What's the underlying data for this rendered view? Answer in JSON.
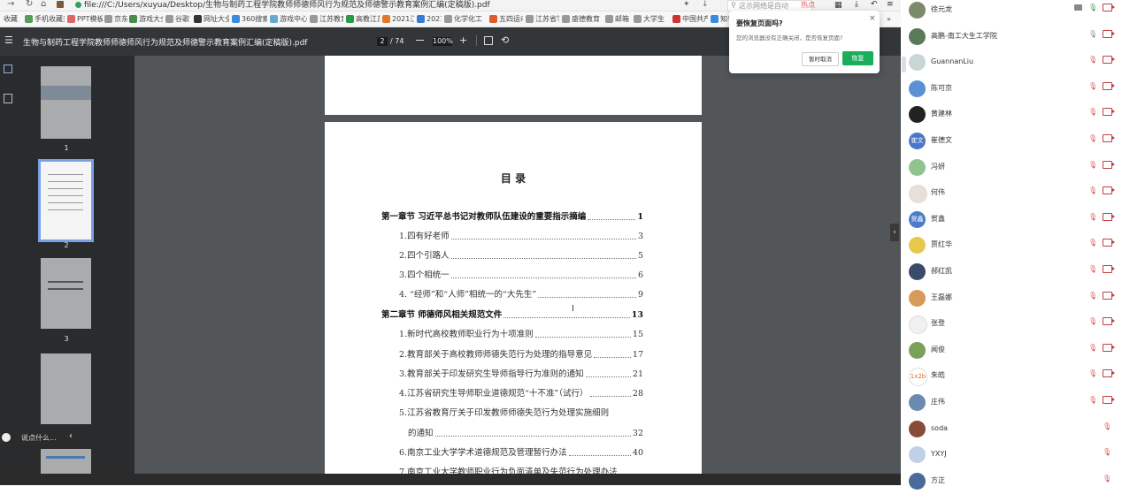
{
  "browser": {
    "url": "file:///C:/Users/xuyua/Desktop/生物与制药工程学院教师师德师风行为规范及师德警示教育案例汇编(定稿版).pdf",
    "search_placeholder": "这示网络是自动",
    "hot_label": "热点",
    "bookmarks_label": "收藏",
    "bookmarks": [
      "手机收藏夹",
      "PPT模板",
      "京东",
      "游戏大全",
      "谷歌",
      "网址大全",
      "360搜索",
      "游戏中心",
      "江苏教育",
      "高教江苏",
      "2021江苏",
      "2021年",
      "化学化工",
      "五四运动",
      "江苏省学",
      "盛德教育",
      "邮箱",
      "大学生",
      "中国共产",
      "知乎"
    ]
  },
  "pdf": {
    "title": "生物与制药工程学院教师师德师风行为规范及师德警示教育案例汇编(定稿版).pdf",
    "page_current": "2",
    "page_total": "/ 74",
    "zoom": "100%",
    "thumbs": [
      "1",
      "2",
      "3"
    ],
    "toc_title": "目  录",
    "toc": [
      {
        "text": "第一章节   习近平总书记对教师队伍建设的重要指示摘编",
        "page": "1",
        "chapter": true
      },
      {
        "text": "1.四有好老师",
        "page": "3"
      },
      {
        "text": "2.四个引路人",
        "page": "5"
      },
      {
        "text": "3.四个相统一",
        "page": "6"
      },
      {
        "text": "4. “经师”和“人师”相统一的“大先生”",
        "page": "9"
      },
      {
        "text": "第二章节   师德师风相关规范文件",
        "page": "13",
        "chapter": true
      },
      {
        "text": "1.新时代高校教师职业行为十项准则",
        "page": "15"
      },
      {
        "text": "2.教育部关于高校教师师德失范行为处理的指导意见",
        "page": "17"
      },
      {
        "text": "3.教育部关于印发研究生导师指导行为准则的通知",
        "page": "21"
      },
      {
        "text": "4.江苏省研究生导师职业道德规范“十不准”（试行）",
        "page": "28"
      },
      {
        "text": "5.江苏省教育厅关于印发教师师德失范行为处理实施细则",
        "page": ""
      },
      {
        "text": "的通知",
        "page": "32"
      },
      {
        "text": "6.南京工业大学学术道德规范及管理暂行办法",
        "page": "40"
      },
      {
        "text": "7.南京工业大学教师职业行为负面清单及失范行为处理办法",
        "page": ""
      }
    ]
  },
  "popup": {
    "title": "要恢复页面吗?",
    "message": "您的浏览器没有正确关闭，是否恢复页面?",
    "secondary_label": "暂时取消",
    "primary_label": "恢复"
  },
  "chat": {
    "placeholder": "说点什么..."
  },
  "participants": [
    {
      "name": "徐元龙",
      "avatar_color": "#7a8a6a",
      "mic": "on"
    },
    {
      "name": "高鹏-南工大生工学院",
      "avatar_color": "#5a7a5a",
      "mic": "on-gray"
    },
    {
      "name": "GuannanLiu",
      "avatar_color": "#c9d6d6",
      "mic": "off"
    },
    {
      "name": "陈可京",
      "avatar_color": "#5b8fd6",
      "mic": "off"
    },
    {
      "name": "黄建林",
      "avatar_color": "#222222",
      "mic": "off"
    },
    {
      "name": "崔德文",
      "avatar_color": "#4a78c8",
      "mic": "off",
      "avatar_text": "崔文"
    },
    {
      "name": "冯妍",
      "avatar_color": "#8fc48f",
      "mic": "off"
    },
    {
      "name": "何伟",
      "avatar_color": "#e8e0d8",
      "mic": "off"
    },
    {
      "name": "贺鑫",
      "avatar_color": "#4a7cc9",
      "mic": "off",
      "avatar_text": "贺鑫"
    },
    {
      "name": "贾红华",
      "avatar_color": "#e7c84a",
      "mic": "off"
    },
    {
      "name": "郝红凯",
      "avatar_color": "#3a4a6a",
      "mic": "off"
    },
    {
      "name": "王磊娜",
      "avatar_color": "#d89a5a",
      "mic": "off"
    },
    {
      "name": "张登",
      "avatar_color": "#f0f0f0",
      "mic": "off"
    },
    {
      "name": "闻俊",
      "avatar_color": "#7aa05a",
      "mic": "off"
    },
    {
      "name": "朱皓",
      "avatar_color": "#ffffff",
      "mic": "off",
      "avatar_text": "1x2b"
    },
    {
      "name": "庄伟",
      "avatar_color": "#6a8ab0",
      "mic": "off"
    },
    {
      "name": "soda",
      "avatar_color": "#8a4a3a",
      "mic": "off-only"
    },
    {
      "name": "YXYJ",
      "avatar_color": "#c0d0e8",
      "mic": "off-only"
    },
    {
      "name": "方正",
      "avatar_color": "#4a6a9a",
      "mic": "off-only"
    }
  ]
}
